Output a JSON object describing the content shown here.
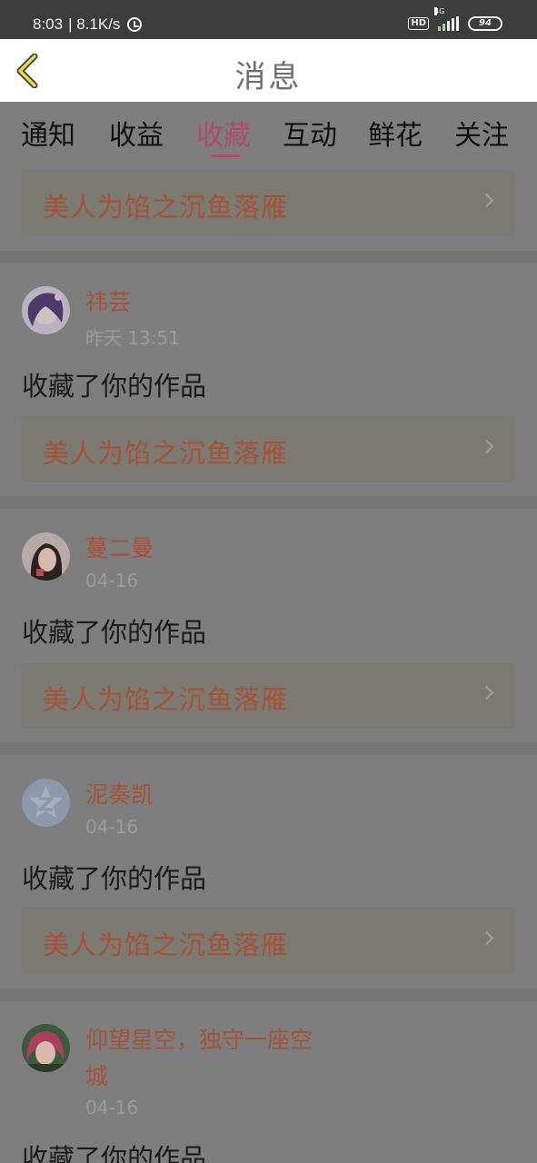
{
  "status_bar": {
    "time": "8:03",
    "speed": "| 8.1K/s",
    "hd": "HD",
    "network": "4G",
    "battery": "94"
  },
  "header": {
    "title": "消息"
  },
  "tabs": [
    {
      "label": "通知",
      "active": false
    },
    {
      "label": "收益",
      "active": false
    },
    {
      "label": "收藏",
      "active": true
    },
    {
      "label": "互动",
      "active": false
    },
    {
      "label": "鲜花",
      "active": false
    },
    {
      "label": "关注",
      "active": false
    }
  ],
  "top_partial": {
    "work_title": "美人为馅之沉鱼落雁"
  },
  "items": [
    {
      "user": "祎芸",
      "time": "昨天 13:51",
      "action": "收藏了你的作品",
      "work_title": "美人为馅之沉鱼落雁"
    },
    {
      "user": "蔓二曼",
      "time": "04-16",
      "action": "收藏了你的作品",
      "work_title": "美人为馅之沉鱼落雁"
    },
    {
      "user": "泥奏凯",
      "time": "04-16",
      "action": "收藏了你的作品",
      "work_title": "美人为馅之沉鱼落雁"
    },
    {
      "user_line1": "仰望星空，独守一座空",
      "user_line2": "城",
      "time": "04-16",
      "action": "收藏了你的作品"
    }
  ],
  "colors": {
    "accent": "#b24a70",
    "link_text": "#a75236",
    "overlay": "#7e7e7e"
  }
}
